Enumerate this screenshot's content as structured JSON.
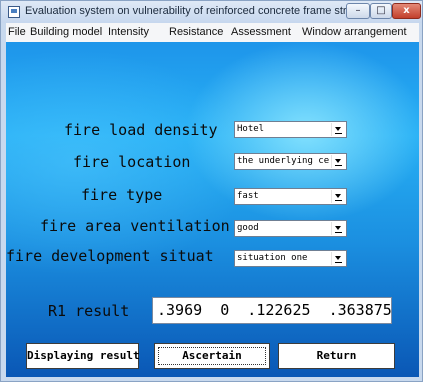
{
  "window": {
    "title": "Evaluation system on vulnerability of reinforced concrete frame struc...",
    "controls": {
      "minimize": "–",
      "maximize": "□",
      "close": "x"
    }
  },
  "menu": [
    "File",
    "Building model",
    "Intensity",
    "Resistance",
    "Assessment",
    "Window arrangement"
  ],
  "form": {
    "fields": [
      {
        "label": "fire load density",
        "value": "Hotel"
      },
      {
        "label": "fire location",
        "value": "the underlying center"
      },
      {
        "label": "fire type",
        "value": "fast"
      },
      {
        "label": "fire area ventilation",
        "value": "good"
      },
      {
        "label": "fire development situat",
        "value": "situation one"
      }
    ],
    "result_label": "R1 result",
    "result_value": ".3969  0  .122625  .363875"
  },
  "buttons": {
    "display": "Displaying result",
    "ascertain": "Ascertain",
    "return": "Return"
  }
}
